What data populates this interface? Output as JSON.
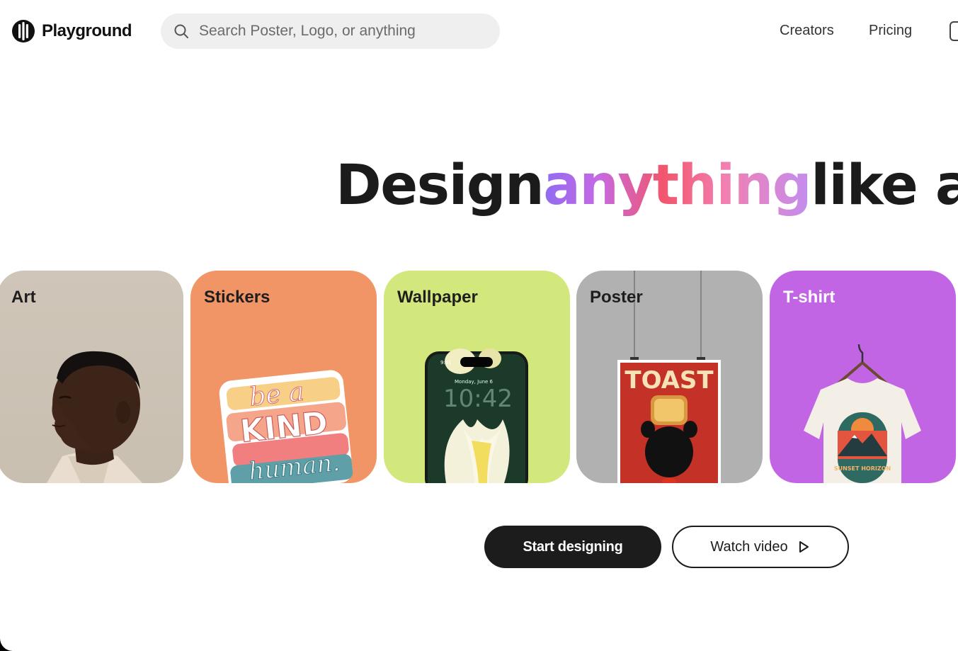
{
  "header": {
    "brand": "Playground",
    "search_placeholder": "Search Poster, Logo, or anything",
    "nav": [
      "Creators",
      "Pricing"
    ]
  },
  "hero": {
    "prefix": "Design",
    "highlight": "anything",
    "suffix": "like a pr"
  },
  "cards": [
    {
      "label": "Art",
      "image": "portrait-illustration"
    },
    {
      "label": "Stickers",
      "image": "be-a-kind-human-sticker"
    },
    {
      "label": "Wallpaper",
      "image": "phone-tulip-wallpaper",
      "phone_time": "9:41",
      "phone_date": "Monday, June 6",
      "phone_clock": "10:42"
    },
    {
      "label": "Poster",
      "image": "toast-poster",
      "poster_text": "TOAST"
    },
    {
      "label": "T-shirt",
      "image": "sunset-horizon-tshirt",
      "shirt_text": "SUNSET HORIZON"
    }
  ],
  "sticker_text": [
    "be a",
    "KIND",
    "human."
  ],
  "actions": {
    "start": "Start designing",
    "watch": "Watch video"
  },
  "colors": {
    "stickers_bg": "#f19566",
    "wallpaper_bg": "#d3e87c",
    "poster_bg": "#b1b1b1",
    "tshirt_bg": "#c265e5",
    "primary_button": "#1c1c1c"
  }
}
